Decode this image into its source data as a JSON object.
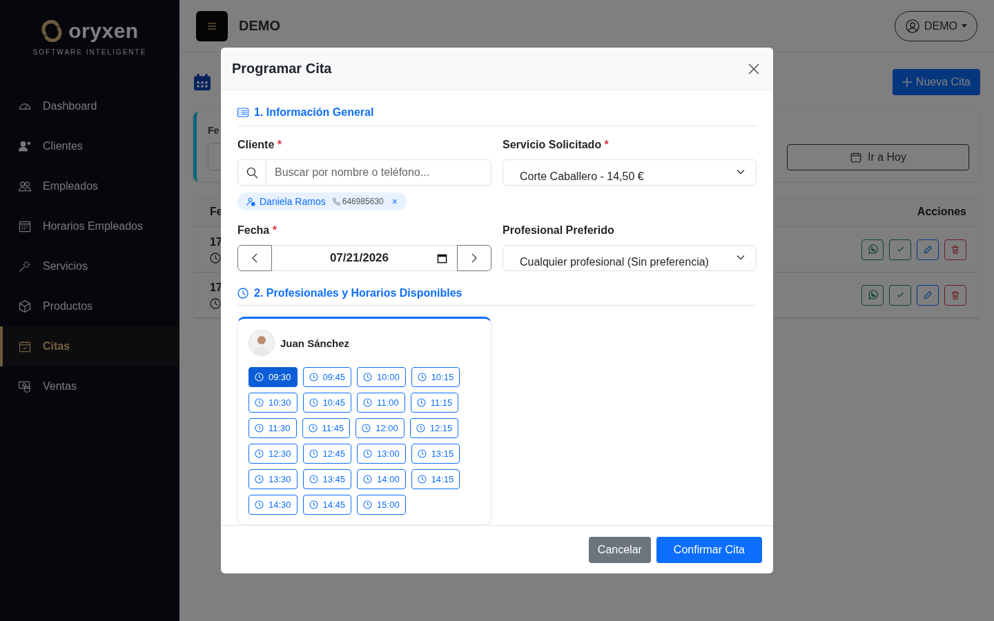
{
  "sidebar": {
    "logo": "oryxen",
    "tagline": "SOFTWARE INTELIGENTE",
    "items": [
      {
        "label": "Dashboard",
        "selected": false
      },
      {
        "label": "Clientes",
        "selected": false
      },
      {
        "label": "Empleados",
        "selected": false
      },
      {
        "label": "Horarios Empleados",
        "selected": false
      },
      {
        "label": "Servicios",
        "selected": false
      },
      {
        "label": "Productos",
        "selected": false
      },
      {
        "label": "Citas",
        "selected": true
      },
      {
        "label": "Ventas",
        "selected": false
      }
    ]
  },
  "header": {
    "title": "DEMO",
    "user": "DEMO"
  },
  "page": {
    "new_button": "Nueva Cita",
    "filter": {
      "label": "Fe",
      "today_button": "Ir a Hoy"
    },
    "table": {
      "columns": [
        "Fe",
        "Acciones"
      ],
      "rows": [
        {
          "date": "17"
        },
        {
          "date": "17"
        }
      ]
    }
  },
  "modal": {
    "title": "Programar Cita",
    "section_1": "1. Información General",
    "cliente": {
      "label": "Cliente",
      "required_mark": "*",
      "placeholder": "Buscar por nombre o teléfono...",
      "chip": {
        "name": "Daniela Ramos",
        "phone": "646985630",
        "remove": "×"
      }
    },
    "servicio": {
      "label": "Servicio Solicitado",
      "required_mark": "*",
      "value": "Corte Caballero - 14,50 €"
    },
    "fecha": {
      "label": "Fecha",
      "required_mark": "*",
      "value": "07/21/2026"
    },
    "profesional": {
      "label": "Profesional Preferido",
      "value": "Cualquier profesional (Sin preferencia)"
    },
    "section_2": "2. Profesionales y Horarios Disponibles",
    "professionals": [
      {
        "name": "Juan Sánchez",
        "slots": [
          {
            "time": "09:30",
            "selected": true
          },
          {
            "time": "09:45",
            "selected": false
          },
          {
            "time": "10:00",
            "selected": false
          },
          {
            "time": "10:15",
            "selected": false
          },
          {
            "time": "10:30",
            "selected": false
          },
          {
            "time": "10:45",
            "selected": false
          },
          {
            "time": "11:00",
            "selected": false
          },
          {
            "time": "11:15",
            "selected": false
          },
          {
            "time": "11:30",
            "selected": false
          },
          {
            "time": "11:45",
            "selected": false
          },
          {
            "time": "12:00",
            "selected": false
          },
          {
            "time": "12:15",
            "selected": false
          },
          {
            "time": "12:30",
            "selected": false
          },
          {
            "time": "12:45",
            "selected": false
          },
          {
            "time": "13:00",
            "selected": false
          },
          {
            "time": "13:15",
            "selected": false
          },
          {
            "time": "13:30",
            "selected": false
          },
          {
            "time": "13:45",
            "selected": false
          },
          {
            "time": "14:00",
            "selected": false
          },
          {
            "time": "14:15",
            "selected": false
          },
          {
            "time": "14:30",
            "selected": false
          },
          {
            "time": "14:45",
            "selected": false
          },
          {
            "time": "15:00",
            "selected": false
          }
        ]
      }
    ],
    "buttons": {
      "cancel": "Cancelar",
      "confirm": "Confirmar Cita"
    }
  }
}
